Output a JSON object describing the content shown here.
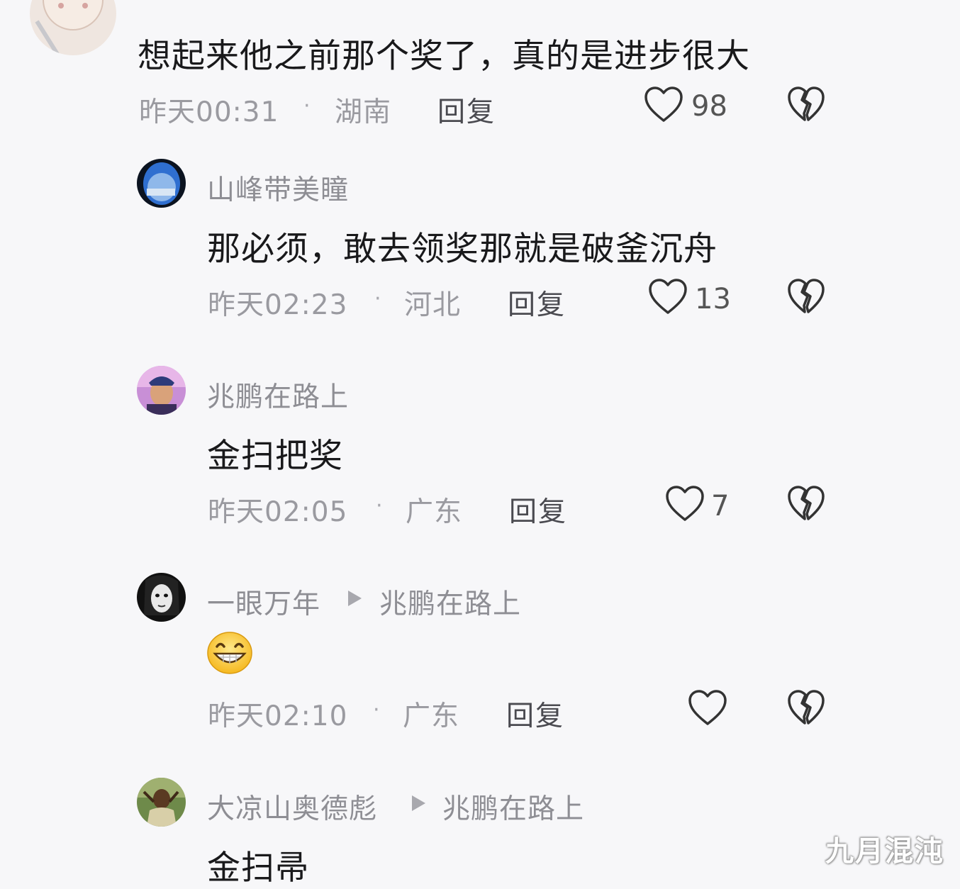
{
  "comments": [
    {
      "body": "想起来他之前那个奖了，真的是进步很大",
      "time": "昨天00:31",
      "location": "湖南",
      "reply": "回复",
      "likes": "98"
    },
    {
      "user": "山峰带美瞳",
      "body": "那必须，敢去领奖那就是破釜沉舟",
      "time": "昨天02:23",
      "location": "河北",
      "reply": "回复",
      "likes": "13"
    },
    {
      "user": "兆鹏在路上",
      "body": "金扫把奖",
      "time": "昨天02:05",
      "location": "广东",
      "reply": "回复",
      "likes": "7"
    },
    {
      "user": "一眼万年",
      "reply_to": "兆鹏在路上",
      "emoji": "grinning-face-emoji",
      "time": "昨天02:10",
      "location": "广东",
      "reply": "回复",
      "likes": ""
    },
    {
      "user": "大凉山奥德彪",
      "reply_to": "兆鹏在路上",
      "body": "金扫帚"
    }
  ],
  "separator": "·",
  "watermark": "九月混沌",
  "icons": {
    "like": "heart-outline-icon",
    "dislike": "broken-heart-icon",
    "reply_arrow": "triangle-right-icon"
  }
}
